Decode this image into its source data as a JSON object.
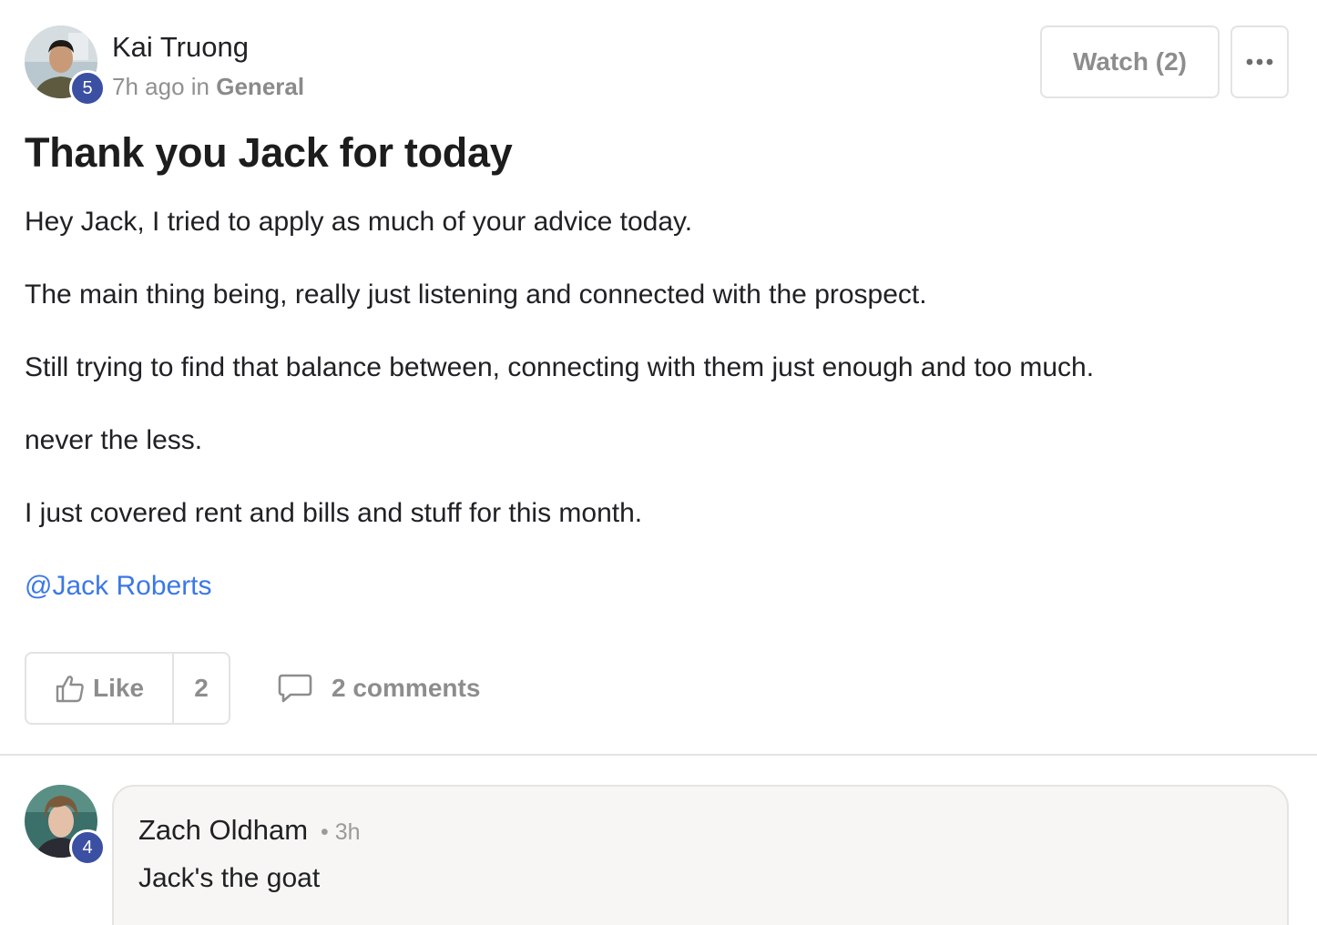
{
  "post": {
    "author": {
      "name": "Kai Truong",
      "level": "5"
    },
    "time": "7h ago",
    "in_word": "in",
    "category": "General",
    "watch_label": "Watch (2)",
    "more_icon": "ellipsis-icon",
    "title": "Thank you Jack for today",
    "paragraphs": [
      "Hey Jack, I tried to apply as much of your advice today.",
      "The main thing being, really just listening and connected with the prospect.",
      "Still trying to find that balance between, connecting with them just enough and too much.",
      "never the less.",
      "I just covered rent and bills and stuff for this month."
    ],
    "mention": "@Jack Roberts"
  },
  "actions": {
    "like_label": "Like",
    "like_count": "2",
    "comments_label": "2 comments"
  },
  "comment": {
    "author": "Zach Oldham",
    "level": "4",
    "time": "• 3h",
    "text": "Jack's the goat"
  }
}
